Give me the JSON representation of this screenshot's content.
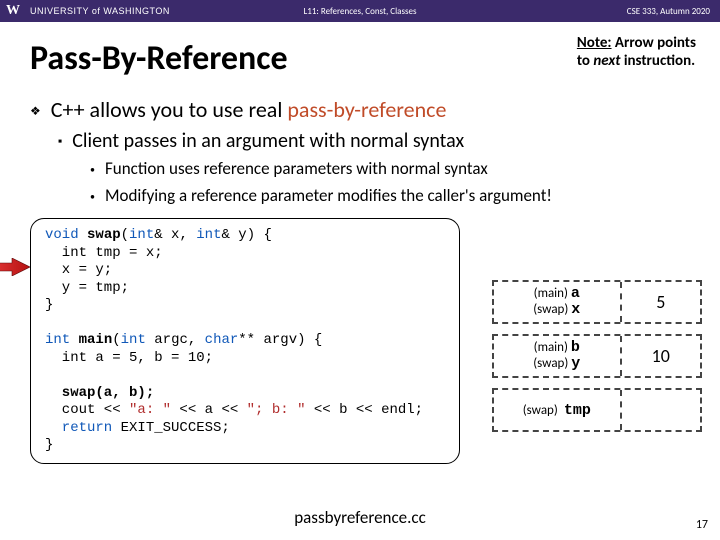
{
  "header": {
    "university": "UNIVERSITY of WASHINGTON",
    "center": "L11: References, Const, Classes",
    "right": "CSE 333, Autumn 2020"
  },
  "title": "Pass-By-Reference",
  "note": {
    "line1a": "Note:",
    "line1b": " Arrow points",
    "line2a": "to ",
    "line2b": "next",
    "line2c": " instruction."
  },
  "bullets": {
    "b1a": "C++ allows you to use real ",
    "b1b": "pass-by-reference",
    "b2": "Client passes in an argument with normal syntax",
    "b3a": "Function uses reference parameters with normal syntax",
    "b3b": "Modifying a reference parameter modifies the caller's argument!"
  },
  "code": {
    "l1a": "void",
    "l1b": " swap",
    "l1c": "(",
    "l1d": "int",
    "l1e": "& x, ",
    "l1f": "int",
    "l1g": "& y) {",
    "l2": "  int tmp = x;",
    "l3": "  x = y;",
    "l4": "  y = tmp;",
    "l5": "}",
    "l6": "",
    "l7a": "int",
    "l7b": " main",
    "l7c": "(",
    "l7d": "int",
    "l7e": " argc, ",
    "l7f": "char",
    "l7g": "** argv) {",
    "l8": "  int a = 5, b = 10;",
    "l9": "",
    "l10": "  swap(a, b);",
    "l11a": "  cout << ",
    "l11b": "\"a: \"",
    "l11c": " << a << ",
    "l11d": "\"; b: \"",
    "l11e": " << b << endl;",
    "l12a": "  return",
    "l12b": " EXIT_SUCCESS;",
    "l13": "}"
  },
  "mem": {
    "r1l1": "(main)",
    "r1m1": "a",
    "r1l2": "(swap)",
    "r1m2": "x",
    "r1v": "5",
    "r2l1": "(main)",
    "r2m1": "b",
    "r2l2": "(swap)",
    "r2m2": "y",
    "r2v": "10",
    "r3l": "(swap)",
    "r3m": "tmp",
    "r3v": ""
  },
  "filename": "passbyreference.cc",
  "pagenum": "17"
}
